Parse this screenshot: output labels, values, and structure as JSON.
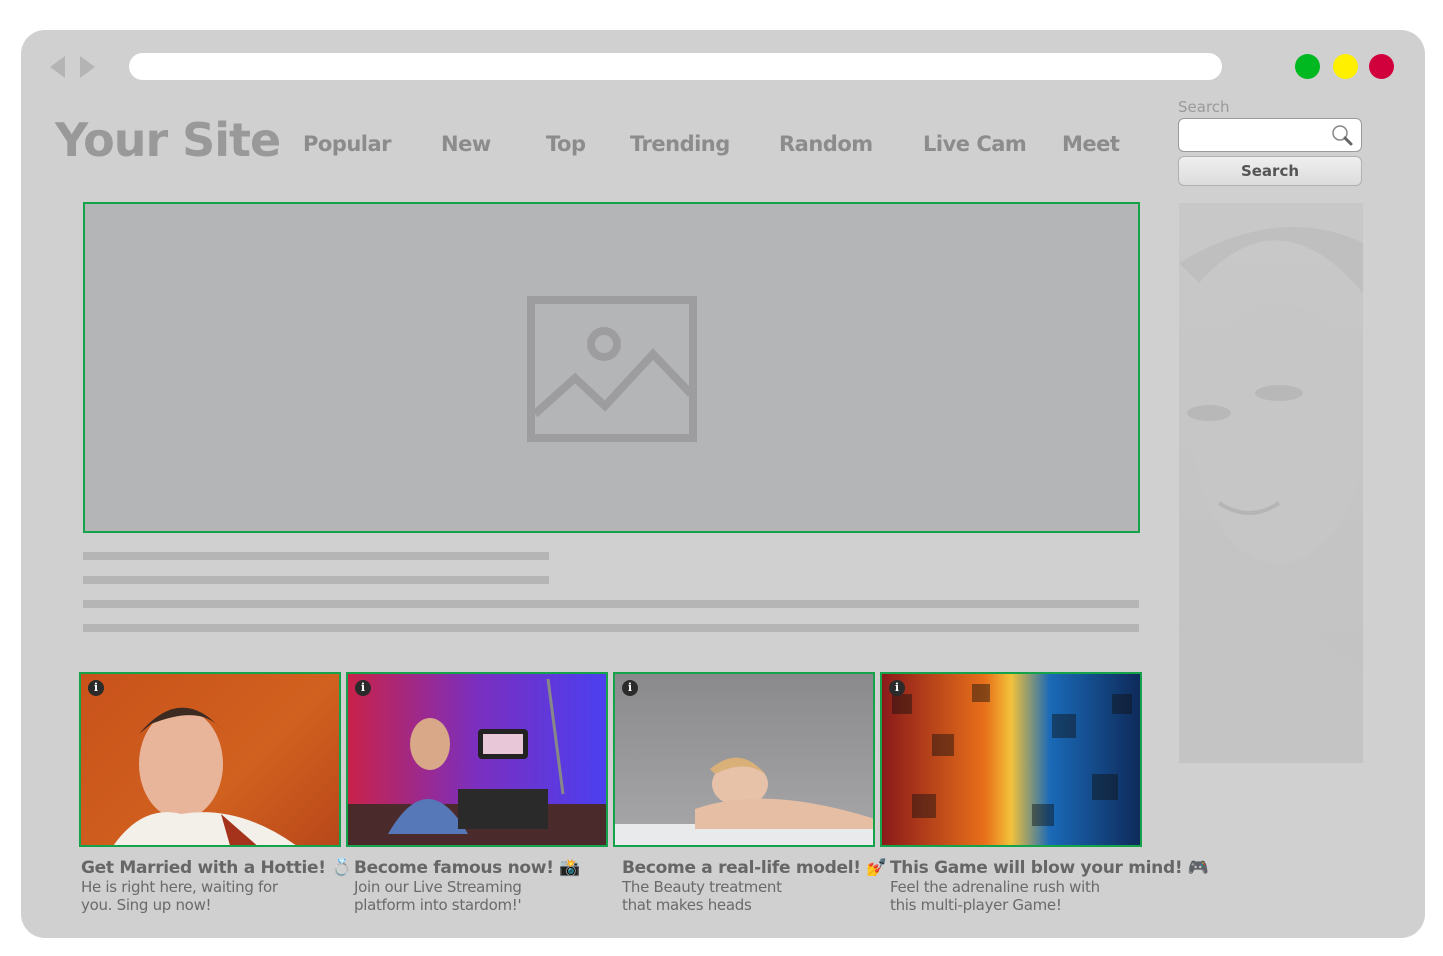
{
  "browser": {
    "controls": [
      "back",
      "forward"
    ],
    "window_dots": [
      {
        "name": "green-dot",
        "color": "#00b81f"
      },
      {
        "name": "yellow-dot",
        "color": "#fff000"
      },
      {
        "name": "red-dot",
        "color": "#d1003c"
      }
    ]
  },
  "header": {
    "site_title": "Your Site",
    "nav": [
      "Popular",
      "New",
      "Top",
      "Trending",
      "Random",
      "Live Cam",
      "Meet"
    ]
  },
  "search": {
    "label": "Search",
    "input_value": "",
    "button_label": "Search"
  },
  "hero": {
    "placeholder_icon": "image-placeholder-icon"
  },
  "colors": {
    "accent_border": "#14a24a",
    "background": "#d0d0d0"
  },
  "cards": [
    {
      "title": "Get Married with a Hottie!",
      "emoji": "💍",
      "desc": "He is right here, waiting for you. Sing up now!",
      "info": "i"
    },
    {
      "title": "Become famous now!",
      "emoji": "📸",
      "desc": "Join our Live Streaming platform into stardom!'",
      "info": "i"
    },
    {
      "title": "Become a real-life model!",
      "emoji": "💅",
      "desc": "The Beauty treatment that makes heads",
      "info": "i"
    },
    {
      "title": "This Game will blow your mind!",
      "emoji": "🎮",
      "desc": "Feel the adrenaline rush with this multi-player Game!",
      "info": "i"
    }
  ]
}
